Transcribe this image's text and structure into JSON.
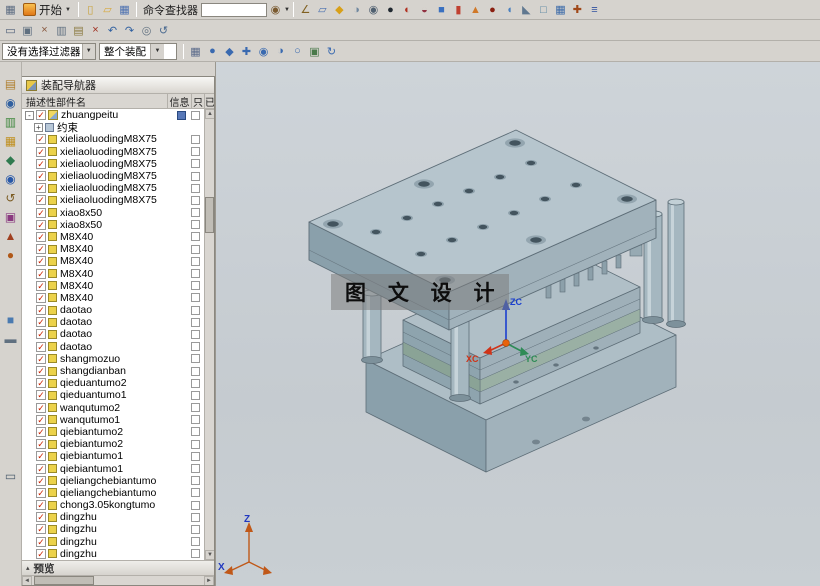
{
  "ui": {
    "scroll": {
      "up": "▲",
      "down": "▼",
      "left": "◄",
      "right": "►"
    }
  },
  "toolbars": {
    "row1": {
      "menu_glyph": "▦",
      "start": {
        "label": "开始",
        "caret": "▼"
      },
      "left_icons": [
        {
          "name": "new-file-icon",
          "glyph": "▯",
          "color": "#c8a23c"
        },
        {
          "name": "open-icon",
          "glyph": "▱",
          "color": "#d8a83c"
        },
        {
          "name": "save-icon",
          "glyph": "▦",
          "color": "#4a6fb0"
        }
      ],
      "command_finder": {
        "label": "命令查找器",
        "value": "",
        "button_glyph": "◉",
        "caret": "▼"
      },
      "right_icons": [
        {
          "name": "sketch-icon",
          "glyph": "∠",
          "color": "#806020"
        },
        {
          "name": "datum-plane-icon",
          "glyph": "▱",
          "color": "#4a70b0"
        },
        {
          "name": "extrude-icon",
          "glyph": "◆",
          "color": "#d8a018"
        },
        {
          "name": "revolve-icon",
          "glyph": "◑",
          "color": "#7088a0"
        },
        {
          "name": "hole-icon",
          "glyph": "◉",
          "color": "#506070"
        },
        {
          "name": "boolean-unite-icon",
          "glyph": "●",
          "color": "#202830"
        },
        {
          "name": "boolean-subtract-icon",
          "glyph": "◐",
          "color": "#b03020"
        },
        {
          "name": "boolean-intersect-icon",
          "glyph": "◒",
          "color": "#903040"
        },
        {
          "name": "block-icon",
          "glyph": "■",
          "color": "#3a70c0"
        },
        {
          "name": "cylinder-icon",
          "glyph": "▮",
          "color": "#c04030"
        },
        {
          "name": "cone-icon",
          "glyph": "▲",
          "color": "#d07828"
        },
        {
          "name": "sphere-icon",
          "glyph": "●",
          "color": "#8a1f10"
        },
        {
          "name": "edge-blend-icon",
          "glyph": "◖",
          "color": "#4a80c0"
        },
        {
          "name": "chamfer-icon",
          "glyph": "◣",
          "color": "#607890"
        },
        {
          "name": "shell-icon",
          "glyph": "□",
          "color": "#5080a0"
        },
        {
          "name": "pattern-feature-icon",
          "glyph": "▦",
          "color": "#3868a8"
        },
        {
          "name": "move-component-icon",
          "glyph": "✚",
          "color": "#a04818"
        },
        {
          "name": "assembly-constraints-icon",
          "glyph": "≡",
          "color": "#3050a0"
        }
      ]
    },
    "row2": {
      "icons": [
        {
          "name": "touch-mode-icon",
          "glyph": "▭",
          "color": "#50607a"
        },
        {
          "name": "window-icon",
          "glyph": "▣",
          "color": "#607080"
        },
        {
          "name": "cut-icon",
          "glyph": "×",
          "color": "#8a5a40"
        },
        {
          "name": "copy-icon",
          "glyph": "▥",
          "color": "#607080"
        },
        {
          "name": "paste-icon",
          "glyph": "▤",
          "color": "#8a7a40"
        },
        {
          "name": "delete-icon",
          "glyph": "×",
          "color": "#a03020"
        },
        {
          "name": "undo-icon",
          "glyph": "↶",
          "color": "#3060a0"
        },
        {
          "name": "redo-icon",
          "glyph": "↷",
          "color": "#3060a0"
        },
        {
          "name": "gear-icon",
          "glyph": "◎",
          "color": "#607080"
        },
        {
          "name": "helix-icon",
          "glyph": "↺",
          "color": "#4a6a90"
        }
      ]
    },
    "row3": {
      "selection_filter": {
        "value": "没有选择过滤器",
        "caret": "▼"
      },
      "scope": {
        "value": "整个装配",
        "caret": "▼"
      },
      "icons": [
        {
          "name": "snap-point-icon",
          "glyph": "▦",
          "color": "#5a6a8a"
        },
        {
          "name": "end-point-icon",
          "glyph": "●",
          "color": "#3a6ab0"
        },
        {
          "name": "midpoint-icon",
          "glyph": "◆",
          "color": "#3a6ab0"
        },
        {
          "name": "intersection-point-icon",
          "glyph": "✚",
          "color": "#3a6ab0"
        },
        {
          "name": "arc-center-icon",
          "glyph": "◉",
          "color": "#3a6ab0"
        },
        {
          "name": "quadrant-point-icon",
          "glyph": "◑",
          "color": "#3a6ab0"
        },
        {
          "name": "point-on-curve-icon",
          "glyph": "○",
          "color": "#3a6ab0"
        },
        {
          "name": "fit-view-icon",
          "glyph": "▣",
          "color": "#4a7a4a"
        },
        {
          "name": "refresh-view-icon",
          "glyph": "↻",
          "color": "#3a6ab0"
        }
      ]
    }
  },
  "side_strip": {
    "icons": [
      {
        "name": "assembly-navigator-icon",
        "glyph": "▤",
        "color": "#b08030"
      },
      {
        "name": "constraint-navigator-icon",
        "glyph": "◉",
        "color": "#3060a0"
      },
      {
        "name": "part-navigator-icon",
        "glyph": "▥",
        "color": "#40883f"
      },
      {
        "name": "reuse-library-icon",
        "glyph": "▦",
        "color": "#c09020"
      },
      {
        "name": "hd3d-tools-icon",
        "glyph": "◆",
        "color": "#2f7a4f"
      },
      {
        "name": "web-browser-icon",
        "glyph": "◉",
        "color": "#2858a8"
      },
      {
        "name": "history-icon",
        "glyph": "↺",
        "color": "#7a5a20"
      },
      {
        "name": "process-studio-icon",
        "glyph": "▣",
        "color": "#8a3a80"
      },
      {
        "name": "manufacturing-wizard-icon",
        "glyph": "▲",
        "color": "#a04020"
      },
      {
        "name": "roles-icon",
        "glyph": "●",
        "color": "#b05818"
      },
      {
        "name": "system-scenes-icon",
        "glyph": "■",
        "color": "#4a7ab0"
      },
      {
        "name": "dependencies-icon",
        "glyph": "▬",
        "color": "#607080"
      },
      {
        "name": "touch-panel-icon",
        "glyph": "▭",
        "color": "#506070"
      }
    ]
  },
  "navigator": {
    "title": "装配导航器",
    "columns": [
      "描述性部件名",
      "信息",
      "只",
      "已"
    ],
    "preview_label": "预览",
    "preview_caret": "▴",
    "items": [
      {
        "type": "root",
        "label": "zhuangpeitu",
        "expanded": true
      },
      {
        "type": "constraints",
        "label": "约束",
        "expanded": false
      },
      {
        "type": "part",
        "label": "xieliaoluodingM8X75"
      },
      {
        "type": "part",
        "label": "xieliaoluodingM8X75"
      },
      {
        "type": "part",
        "label": "xieliaoluodingM8X75"
      },
      {
        "type": "part",
        "label": "xieliaoluodingM8X75"
      },
      {
        "type": "part",
        "label": "xieliaoluodingM8X75"
      },
      {
        "type": "part",
        "label": "xieliaoluodingM8X75"
      },
      {
        "type": "part",
        "label": "xiao8x50"
      },
      {
        "type": "part",
        "label": "xiao8x50"
      },
      {
        "type": "part",
        "label": "M8X40"
      },
      {
        "type": "part",
        "label": "M8X40"
      },
      {
        "type": "part",
        "label": "M8X40"
      },
      {
        "type": "part",
        "label": "M8X40"
      },
      {
        "type": "part",
        "label": "M8X40"
      },
      {
        "type": "part",
        "label": "M8X40"
      },
      {
        "type": "part",
        "label": "daotao"
      },
      {
        "type": "part",
        "label": "daotao"
      },
      {
        "type": "part",
        "label": "daotao"
      },
      {
        "type": "part",
        "label": "daotao"
      },
      {
        "type": "part",
        "label": "shangmozuo"
      },
      {
        "type": "part",
        "label": "shangdianban"
      },
      {
        "type": "part",
        "label": "qieduantumo2"
      },
      {
        "type": "part",
        "label": "qieduantumo1"
      },
      {
        "type": "part",
        "label": "wanqutumo2"
      },
      {
        "type": "part",
        "label": "wanqutumo1"
      },
      {
        "type": "part",
        "label": "qiebiantumo2"
      },
      {
        "type": "part",
        "label": "qiebiantumo2"
      },
      {
        "type": "part",
        "label": "qiebiantumo1"
      },
      {
        "type": "part",
        "label": "qiebiantumo1"
      },
      {
        "type": "part",
        "label": "qieliangchebiantumo"
      },
      {
        "type": "part",
        "label": "qieliangchebiantumo"
      },
      {
        "type": "part",
        "label": "chong3.05kongtumo"
      },
      {
        "type": "part",
        "label": "dingzhu"
      },
      {
        "type": "part",
        "label": "dingzhu"
      },
      {
        "type": "part",
        "label": "dingzhu"
      },
      {
        "type": "part",
        "label": "dingzhu"
      }
    ]
  },
  "viewport": {
    "watermark": "图 文 设 计",
    "triad": {
      "z": "ZC",
      "y": "YC",
      "x": "XC"
    },
    "axes": {
      "z": "Z",
      "x": "X"
    }
  }
}
